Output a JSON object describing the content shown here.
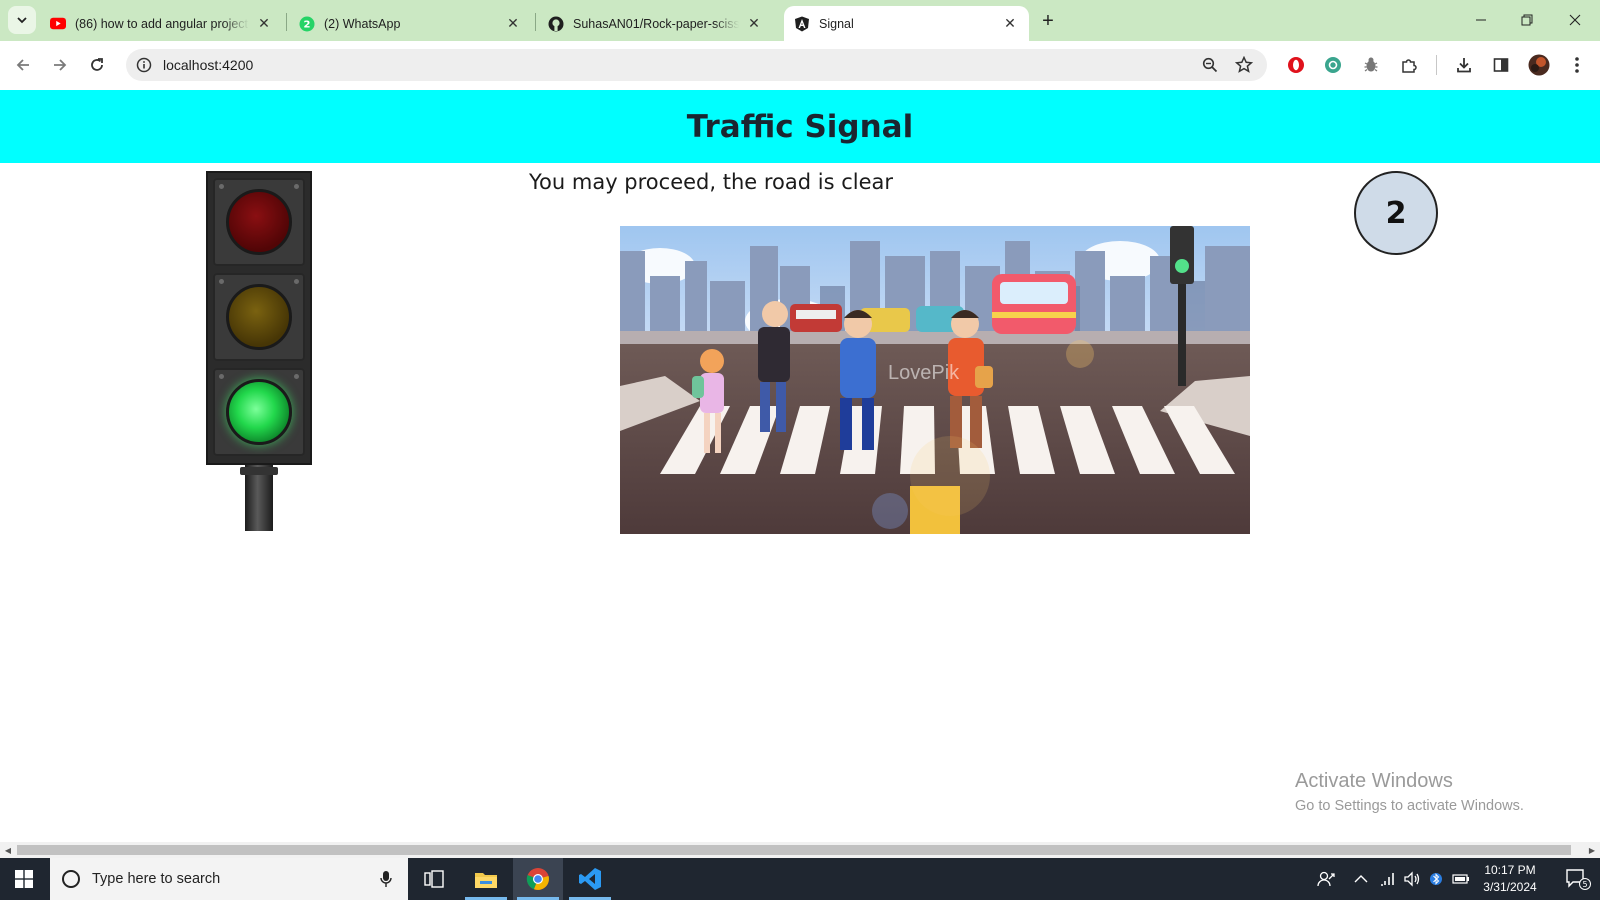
{
  "browser": {
    "tabs": [
      {
        "title": "(86) how to add angular project",
        "favicon": "youtube-icon"
      },
      {
        "title": "(2) WhatsApp",
        "favicon": "whatsapp-icon"
      },
      {
        "title": "SuhasAN01/Rock-paper-scissors",
        "favicon": "github-icon"
      },
      {
        "title": "Signal",
        "favicon": "angular-icon",
        "active": true
      }
    ],
    "url": "localhost:4200"
  },
  "page": {
    "header_title": "Traffic Signal",
    "message": "You may proceed, the road is clear",
    "counter": "2",
    "signal_state": "green",
    "scene_image": "children-crossing-zebra-crosswalk-illustration",
    "watermark": "LovePik"
  },
  "windows_watermark": {
    "line1": "Activate Windows",
    "line2": "Go to Settings to activate Windows."
  },
  "taskbar": {
    "search_placeholder": "Type here to search",
    "time": "10:17 PM",
    "date": "3/31/2024",
    "notification_count": "5"
  },
  "colors": {
    "header_bg": "#00ffff",
    "tab_strip": "#cbe8c3",
    "counter_bg": "#cfdbe8",
    "signal_green": "#22d84c"
  }
}
